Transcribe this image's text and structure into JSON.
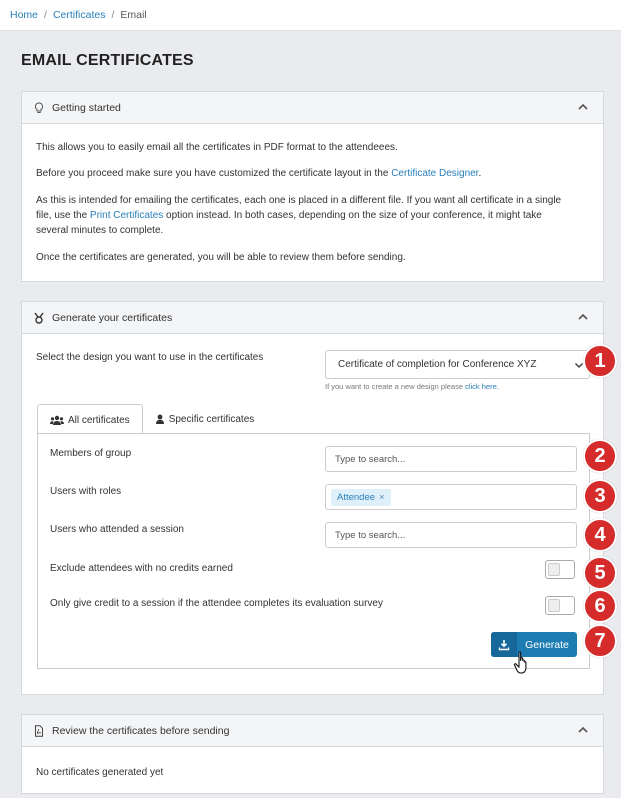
{
  "breadcrumb": {
    "home": "Home",
    "certificates": "Certificates",
    "current": "Email",
    "separator": "/"
  },
  "page": {
    "title": "EMAIL CERTIFICATES"
  },
  "getting_started": {
    "title": "Getting started",
    "icon": "lightbulb-icon",
    "p1": "This allows you to easily email all the certificates in PDF format to the attendeees.",
    "p2_before": "Before you proceed make sure you have customized the certificate layout in the ",
    "p2_link": "Certificate Designer",
    "p2_after": ".",
    "p3_a": "As this is intended for emailing the certificates, each one is placed in a different file. If you want all certificate in a single",
    "p3_b_before": "file, use the ",
    "p3_b_link": "Print Certificates",
    "p3_b_after": " option instead. In both cases, depending on the size of your conference, it might take",
    "p3_c": "several minutes to complete.",
    "p4": "Once the certificates are generated, you will be able to review them before sending."
  },
  "generate": {
    "title": "Generate your certificates",
    "icon": "medal-icon",
    "design_label": "Select the design you want to use in the certificates",
    "design_selected": "Certificate of completion for Conference XYZ",
    "hint_before": "If you want to create a new design please ",
    "hint_link": "click here.",
    "tabs": [
      {
        "label": "All certificates",
        "icon": "users-icon",
        "active": true
      },
      {
        "label": "Specific certificates",
        "icon": "user-icon",
        "active": false
      }
    ],
    "fields": {
      "group_label": "Members of group",
      "group_placeholder": "Type to search...",
      "roles_label": "Users with roles",
      "roles_tag": "Attendee",
      "roles_tag_remove": "×",
      "session_label": "Users who attended a session",
      "session_placeholder": "Type to search...",
      "exclude_label": "Exclude attendees with no credits earned",
      "exclude_on": false,
      "survey_label": "Only give credit to a session if the attendee completes its evaluation survey",
      "survey_on": false
    },
    "button_label": "Generate",
    "button_icon": "download-icon"
  },
  "review": {
    "title": "Review the certificates before sending",
    "icon": "pdf-file-icon",
    "empty_text": "No certificates generated yet"
  },
  "badges": [
    "1",
    "2",
    "3",
    "4",
    "5",
    "6",
    "7"
  ],
  "colors": {
    "accent": "#1d7db3",
    "badge": "#d52b2b",
    "link": "#2a7fb8"
  }
}
